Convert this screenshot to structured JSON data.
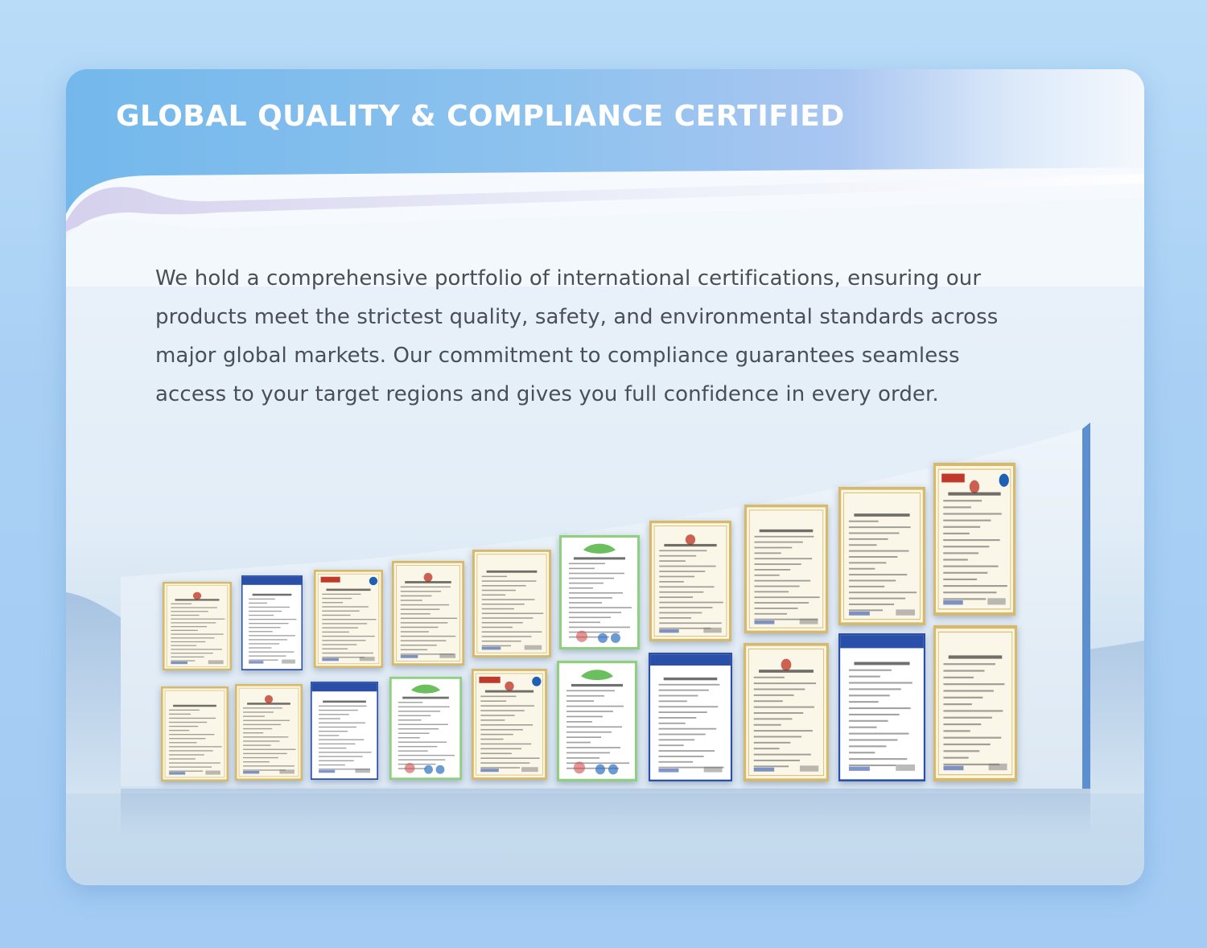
{
  "page": {
    "title": "GLOBAL QUALITY & COMPLIANCE CERTIFIED",
    "intro_line_1": "We hold a comprehensive portfolio of international certifications, ensuring our",
    "intro_line_2": "products meet the strictest quality, safety, and environmental standards across",
    "intro_line_3": "major global markets. Our commitment to compliance guarantees seamless",
    "intro_line_4": "access to your target regions and gives you full confidence in every order."
  },
  "colors": {
    "page_background": "#aed2f5",
    "header_gradient_start": "#73b8ec",
    "header_gradient_end": "#f4f8fd",
    "title_text": "#ffffff",
    "body_text": "#4a4e57",
    "wall_edge": "#5b8fd0",
    "cert_gold_frame": "#d8b968",
    "cert_blue_header": "#2a4fa8",
    "cert_green_frame": "#8fcf7e"
  },
  "certificates": {
    "top_row": [
      {
        "icon": "ce-certificate-icon",
        "frame": "gold"
      },
      {
        "icon": "ce-certificate-blue-header-icon",
        "frame": "blue"
      },
      {
        "icon": "red-header-certificate-icon",
        "frame": "gold"
      },
      {
        "icon": "test-report-certificate-icon",
        "frame": "gold"
      },
      {
        "icon": "conformity-certificate-icon",
        "frame": "gold"
      },
      {
        "icon": "environmental-certificate-icon",
        "frame": "green"
      },
      {
        "icon": "ce-declaration-icon",
        "frame": "gold"
      },
      {
        "icon": "certificate-of-conformity-icon",
        "frame": "gold"
      },
      {
        "icon": "attestation-certificate-icon",
        "frame": "gold"
      },
      {
        "icon": "red-header-test-certificate-icon",
        "frame": "gold"
      }
    ],
    "bottom_row": [
      {
        "icon": "conformity-certificate-icon",
        "frame": "gold"
      },
      {
        "icon": "verification-certificate-icon",
        "frame": "gold"
      },
      {
        "icon": "blue-header-certificate-icon",
        "frame": "blue"
      },
      {
        "icon": "quality-management-certificate-icon",
        "frame": "green"
      },
      {
        "icon": "management-system-certificate-icon",
        "frame": "gold"
      },
      {
        "icon": "environmental-management-certificate-icon",
        "frame": "green"
      },
      {
        "icon": "hec-certificate-icon",
        "frame": "blue"
      },
      {
        "icon": "attestation-certificate-icon",
        "frame": "gold"
      },
      {
        "icon": "ec-type-examination-certificate-icon",
        "frame": "blue"
      },
      {
        "icon": "test-report-certificate-icon",
        "frame": "gold"
      }
    ]
  }
}
